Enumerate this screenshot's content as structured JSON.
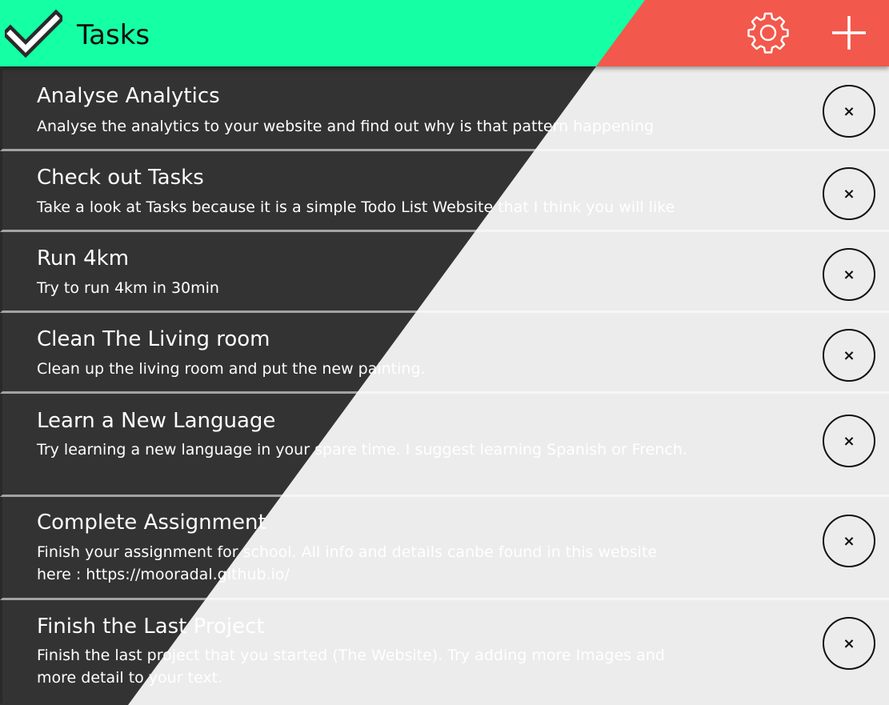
{
  "header": {
    "title": "Tasks",
    "colors": {
      "left": "#15ffa4",
      "right": "#f2584b"
    },
    "icons": {
      "logo": "checkmark-icon",
      "settings": "gear-icon",
      "add": "plus-icon"
    }
  },
  "tasks": [
    {
      "title": "Analyse Analytics",
      "description": "Analyse the analytics to your website and find out why is that pattern happening",
      "close_label": "×"
    },
    {
      "title": "Check out Tasks",
      "description": "Take a look at Tasks because it is a simple Todo List Website that I think you will like",
      "close_label": "×"
    },
    {
      "title": "Run 4km",
      "description": "Try to run 4km in 30min",
      "close_label": "×"
    },
    {
      "title": "Clean The Living room",
      "description": "Clean up the living room and put the new painting.",
      "close_label": "×"
    },
    {
      "title": "Learn a New Language",
      "description": "Try learning a new language in your spare time. I suggest learning Spanish or French.",
      "close_label": "×"
    },
    {
      "title": "Complete Assignment",
      "description": "Finish your assignment for school. All info and details canbe found in this website here : https://mooradal.github.io/",
      "close_label": "×"
    },
    {
      "title": "Finish the Last Project",
      "description": "Finish the last project that you started (The Website). Try adding more Images and more detail to your text.",
      "close_label": "×"
    }
  ]
}
